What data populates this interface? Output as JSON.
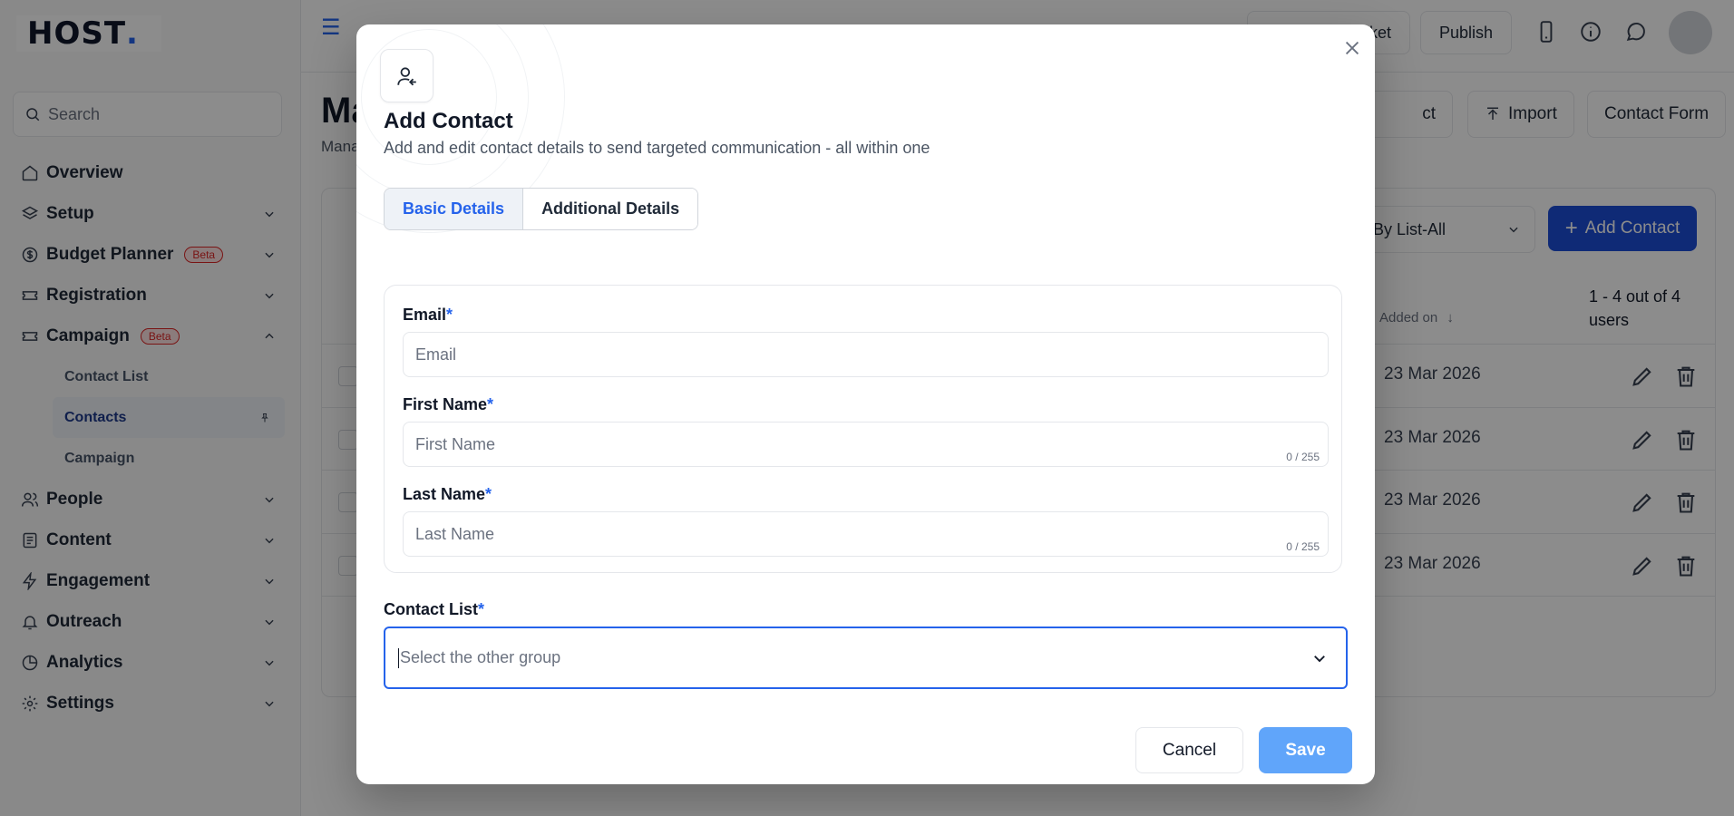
{
  "app": {
    "logo_text": "HOST",
    "logo_dot": "."
  },
  "sidebar": {
    "search_placeholder": "Search",
    "items": [
      {
        "label": "Overview",
        "icon": "home-icon",
        "chevron": false,
        "beta": ""
      },
      {
        "label": "Setup",
        "icon": "layers-icon",
        "chevron": true,
        "beta": ""
      },
      {
        "label": "Budget Planner",
        "icon": "dollar-circle-icon",
        "chevron": true,
        "beta": "Beta"
      },
      {
        "label": "Registration",
        "icon": "ticket-icon",
        "chevron": true,
        "beta": ""
      },
      {
        "label": "Campaign",
        "icon": "ticket-icon",
        "chevron": "up",
        "beta": "Beta"
      }
    ],
    "campaign_sub": [
      {
        "label": "Contact List",
        "active": false
      },
      {
        "label": "Contacts",
        "active": true
      },
      {
        "label": "Campaign",
        "active": false
      }
    ],
    "items_after": [
      {
        "label": "People",
        "icon": "users-icon"
      },
      {
        "label": "Content",
        "icon": "file-icon"
      },
      {
        "label": "Engagement",
        "icon": "bolt-icon"
      },
      {
        "label": "Outreach",
        "icon": "bell-icon"
      },
      {
        "label": "Analytics",
        "icon": "pie-chart-icon"
      },
      {
        "label": "Settings",
        "icon": "gear-icon"
      }
    ]
  },
  "topbar": {
    "ticket_label": "ket",
    "publish_label": "Publish"
  },
  "page": {
    "title_partial": "Ma",
    "subtitle_partial": "Mana",
    "btn_contact_partial": "ct",
    "btn_import": "Import",
    "btn_contact_form": "Contact Form",
    "filter_label": "r By List-All",
    "add_contact": "Add Contact",
    "col_added_on": "Added on",
    "count_text": "1 - 4 out of 4 users",
    "rows": [
      {
        "date": "23 Mar 2026"
      },
      {
        "date": "23 Mar 2026"
      },
      {
        "date": "23 Mar 2026"
      },
      {
        "date": "23 Mar 2026"
      }
    ]
  },
  "modal": {
    "title": "Add Contact",
    "subtitle": "Add and edit contact details to send targeted communication - all within one",
    "tabs": [
      {
        "label": "Basic Details",
        "active": true
      },
      {
        "label": "Additional Details",
        "active": false
      }
    ],
    "fields": {
      "email_label": "Email",
      "email_placeholder": "Email",
      "first_label": "First Name",
      "first_placeholder": "First Name",
      "first_count": "0 / 255",
      "last_label": "Last Name",
      "last_placeholder": "Last Name",
      "last_count": "0 / 255",
      "required_mark": "*"
    },
    "contact_list_label": "Contact List",
    "contact_list_placeholder": "Select the other group",
    "cancel_label": "Cancel",
    "save_label": "Save"
  },
  "colors": {
    "accent": "#2563eb",
    "primary_button": "#1d4ed8",
    "save_disabled": "#60a5fa",
    "beta_red": "#dc2626"
  }
}
